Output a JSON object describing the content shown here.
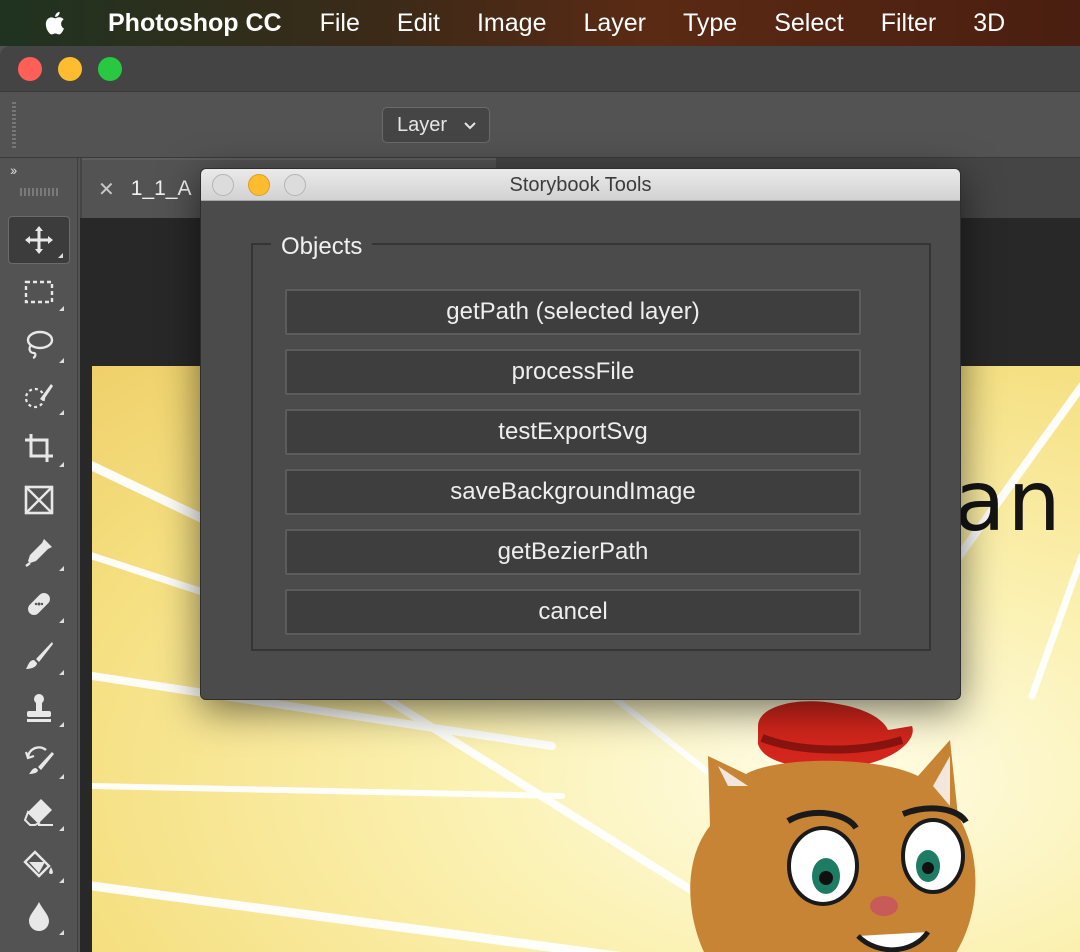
{
  "menubar": {
    "app_name": "Photoshop CC",
    "items": [
      "File",
      "Edit",
      "Image",
      "Layer",
      "Type",
      "Select",
      "Filter",
      "3D"
    ]
  },
  "options_bar": {
    "auto_select_target": "Layer"
  },
  "document": {
    "tab_title": "1_1_A",
    "visible_text": "an"
  },
  "tools": [
    {
      "name": "move-tool-icon"
    },
    {
      "name": "marquee-tool-icon"
    },
    {
      "name": "lasso-tool-icon"
    },
    {
      "name": "quick-selection-tool-icon"
    },
    {
      "name": "crop-tool-icon"
    },
    {
      "name": "frame-tool-icon"
    },
    {
      "name": "eyedropper-tool-icon"
    },
    {
      "name": "healing-brush-tool-icon"
    },
    {
      "name": "brush-tool-icon"
    },
    {
      "name": "clone-stamp-tool-icon"
    },
    {
      "name": "history-brush-tool-icon"
    },
    {
      "name": "eraser-tool-icon"
    },
    {
      "name": "paint-bucket-tool-icon"
    },
    {
      "name": "blur-tool-icon"
    }
  ],
  "dialog": {
    "title": "Storybook Tools",
    "group_label": "Objects",
    "buttons": [
      "getPath (selected layer)",
      "processFile",
      "testExportSvg",
      "saveBackgroundImage",
      "getBezierPath",
      "cancel"
    ]
  },
  "colors": {
    "ui_background": "#535353",
    "dialog_background": "#4b4b4b",
    "button_background": "#3e3e3e"
  }
}
